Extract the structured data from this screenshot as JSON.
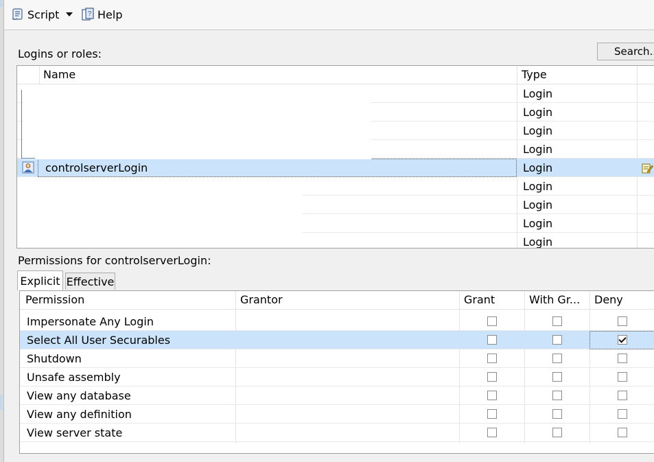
{
  "toolbar": {
    "script_label": "Script",
    "help_label": "Help"
  },
  "logins": {
    "title": "Logins or roles:",
    "search_label": "Search...",
    "columns": {
      "name": "Name",
      "type": "Type"
    },
    "rows": [
      {
        "name": "",
        "type": "Login"
      },
      {
        "name": "",
        "type": "Login"
      },
      {
        "name": "",
        "type": "Login"
      },
      {
        "name": "",
        "type": "Login"
      },
      {
        "name": "controlserverLogin",
        "type": "Login"
      },
      {
        "name": "",
        "type": "Login"
      },
      {
        "name": "",
        "type": "Login"
      },
      {
        "name": "",
        "type": "Login"
      },
      {
        "name": "",
        "type": "Login"
      }
    ]
  },
  "permissions": {
    "title": "Permissions for controlserverLogin:",
    "tabs": [
      "Explicit",
      "Effective"
    ],
    "columns": {
      "permission": "Permission",
      "grantor": "Grantor",
      "grant": "Grant",
      "with_grant": "With Gr...",
      "deny": "Deny"
    },
    "rows": [
      {
        "permission": "Impersonate Any Login",
        "grantor": "",
        "grant": false,
        "with_grant": false,
        "deny": false
      },
      {
        "permission": "Select All User Securables",
        "grantor": "",
        "grant": false,
        "with_grant": false,
        "deny": true
      },
      {
        "permission": "Shutdown",
        "grantor": "",
        "grant": false,
        "with_grant": false,
        "deny": false
      },
      {
        "permission": "Unsafe assembly",
        "grantor": "",
        "grant": false,
        "with_grant": false,
        "deny": false
      },
      {
        "permission": "View any database",
        "grantor": "",
        "grant": false,
        "with_grant": false,
        "deny": false
      },
      {
        "permission": "View any definition",
        "grantor": "",
        "grant": false,
        "with_grant": false,
        "deny": false
      },
      {
        "permission": "View server state",
        "grantor": "",
        "grant": false,
        "with_grant": false,
        "deny": false
      }
    ]
  },
  "colors": {
    "selection": "#cce4fb",
    "window_bg": "#f0f0f0"
  }
}
